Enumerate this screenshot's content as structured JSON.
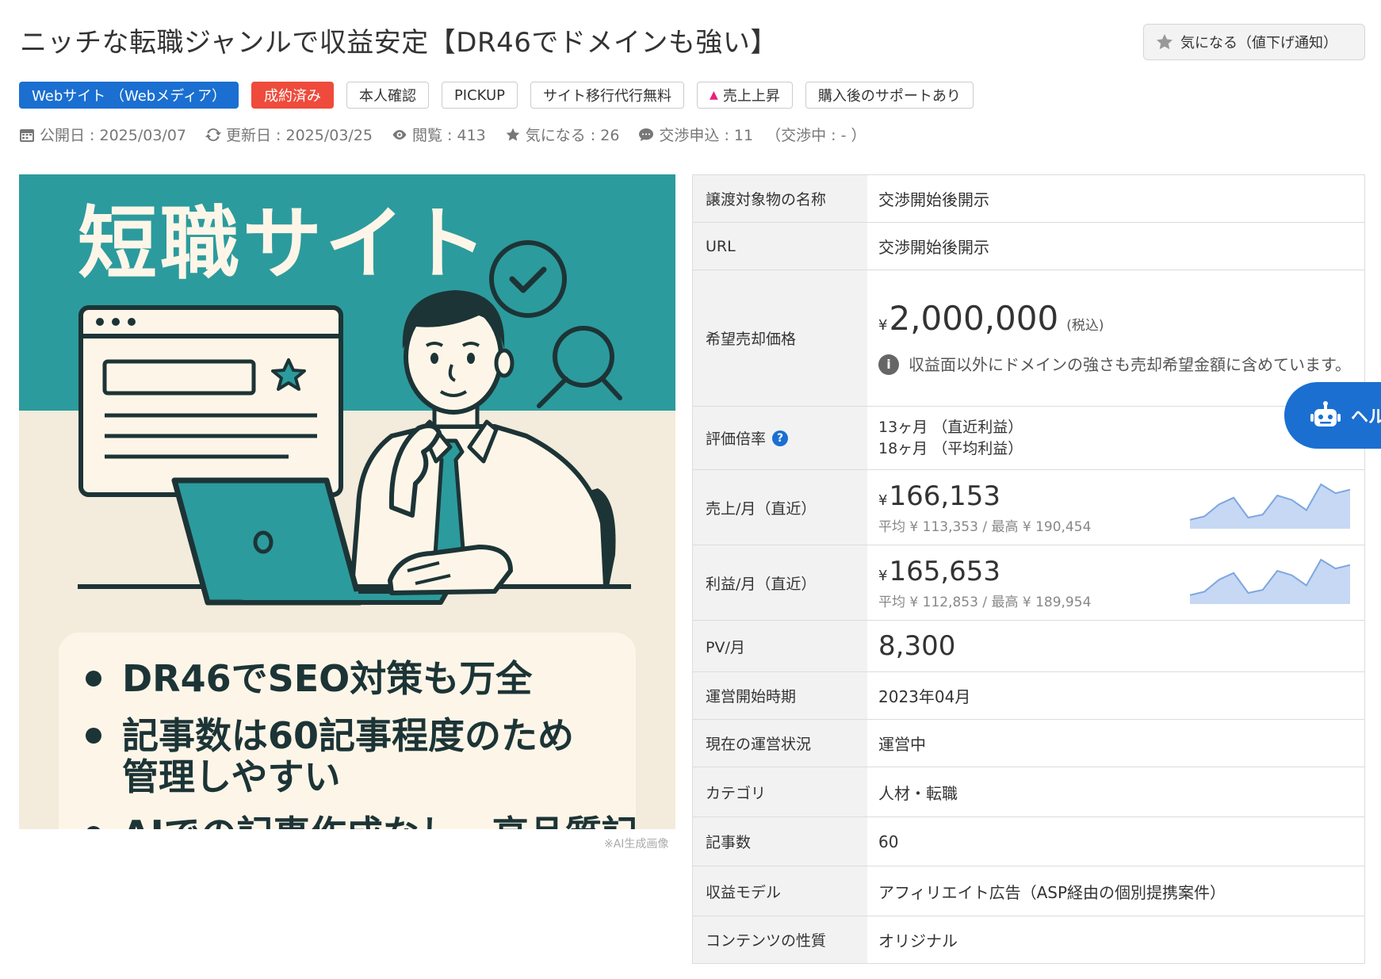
{
  "title": "ニッチな転職ジャンルで収益安定【DR46でドメインも強い】",
  "favorite_button": {
    "label": "気になる（値下げ通知）",
    "icon": "star-icon"
  },
  "tags": [
    {
      "label": "Webサイト （Webメディア）",
      "style": "blue"
    },
    {
      "label": "成約済み",
      "style": "red"
    },
    {
      "label": "本人確認",
      "style": "plain"
    },
    {
      "label": "PICKUP",
      "style": "plain"
    },
    {
      "label": "サイト移行代行無料",
      "style": "plain"
    },
    {
      "label": "売上上昇",
      "style": "plain"
    },
    {
      "label": "購入後のサポートあり",
      "style": "plain"
    }
  ],
  "meta": {
    "published": "公開日 : 2025/03/07",
    "updated": "更新日 : 2025/03/25",
    "views": "閲覧 : 413",
    "favorites": "気になる : 26",
    "offers": "交渉申込 : 11",
    "negotiating": "（交渉中 : - ）"
  },
  "hero": {
    "headline": "短職サイト",
    "bullets": [
      "DR46でSEO対策も万全",
      "記事数は60記事程度のため",
      "管理しやすい",
      "AIでの記事作成なし、高品質記"
    ],
    "caption": "※AI生成画像"
  },
  "spec": {
    "name": {
      "label": "譲渡対象物の名称",
      "value": "交渉開始後開示"
    },
    "url": {
      "label": "URL",
      "value": "交渉開始後開示"
    },
    "price": {
      "label": "希望売却価格",
      "yen": "¥",
      "value": "2,000,000",
      "tax": "(税込)",
      "note": "収益面以外にドメインの強さも売却希望金額に含めています。"
    },
    "multiple": {
      "label": "評価倍率",
      "line1": "13ヶ月 （直近利益）",
      "line2": "18ヶ月 （平均利益）"
    },
    "sales": {
      "label": "売上/月（直近）",
      "yen": "¥",
      "value": "166,153",
      "sub": "平均 ¥ 113,353 / 最高 ¥ 190,454"
    },
    "profit": {
      "label": "利益/月（直近）",
      "yen": "¥",
      "value": "165,653",
      "sub": "平均 ¥ 112,853 / 最高 ¥ 189,954"
    },
    "pv": {
      "label": "PV/月",
      "value": "8,300"
    },
    "start": {
      "label": "運営開始時期",
      "value": "2023年04月"
    },
    "status": {
      "label": "現在の運営状況",
      "value": "運営中"
    },
    "category": {
      "label": "カテゴリ",
      "value": "人材・転職"
    },
    "articles": {
      "label": "記事数",
      "value": "60"
    },
    "model": {
      "label": "収益モデル",
      "value": "アフィリエイト広告（ASP経由の個別提携案件）"
    },
    "content": {
      "label": "コンテンツの性質",
      "value": "オリジナル"
    }
  },
  "sparkline_trend": [
    0.2,
    0.28,
    0.55,
    0.7,
    0.25,
    0.32,
    0.75,
    0.65,
    0.42,
    1.0,
    0.8,
    0.88
  ],
  "help_button": {
    "label": "ヘル"
  },
  "colors": {
    "accent_blue": "#1a6fd1",
    "badge_red": "#ee4b3c",
    "hero_teal": "#2c9b9d"
  }
}
